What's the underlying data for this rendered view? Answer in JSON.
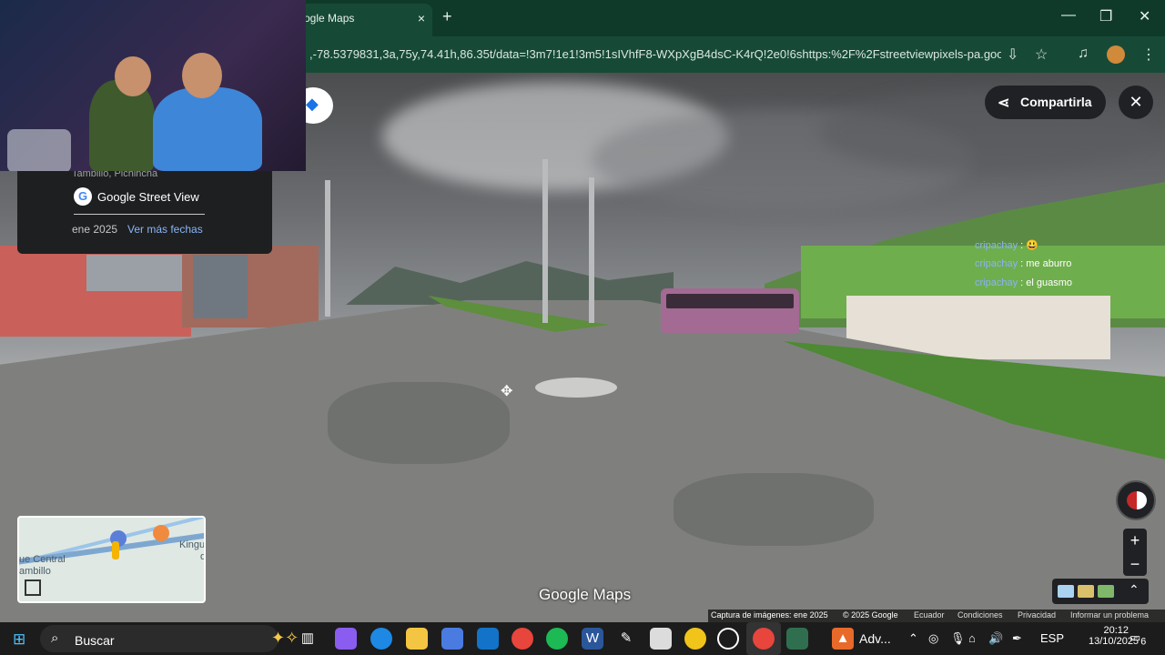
{
  "browser": {
    "tab_title": "ogle Maps",
    "url": ",-78.5379831,3a,75y,74.41h,86.35t/data=!3m7!1e1!3m5!1sIVhfF8-WXpXgB4dsC-K4rQ!2e0!6shttps:%2F%2Fstreetviewpixels-pa.goo...",
    "new_tab_symbol": "+",
    "close_tab_symbol": "×",
    "minimize_symbol": "—",
    "restore_symbol": "❐",
    "close_window_symbol": "✕",
    "tab_bar_color": "#0f3a2a"
  },
  "info_panel": {
    "location": "Tambillo, Pichincha",
    "source": "Google Street View",
    "date": "ene 2025",
    "more_dates": "Ver más fechas"
  },
  "controls": {
    "share_label": "Compartirla",
    "close_symbol": "✕",
    "zoom_in": "+",
    "zoom_out": "−"
  },
  "chat": [
    {
      "user": "cripachay",
      "message": "😃"
    },
    {
      "user": "cripachay",
      "message": "me aburro"
    },
    {
      "user": "cripachay",
      "message": "el guasmo"
    }
  ],
  "minimap": {
    "label_left": "ue Central",
    "label_left2": "ambillo",
    "label_right": "Kingu",
    "label_right2": "d"
  },
  "watermark": "Google Maps",
  "footer": {
    "capture": "Captura de imágenes: ene 2025",
    "copyright": "© 2025 Google",
    "country": "Ecuador",
    "terms": "Condiciones",
    "privacy": "Privacidad",
    "report": "Informar un problema"
  },
  "taskbar": {
    "search_label": "Buscar",
    "active_app_label": "Adv...",
    "language": "ESP",
    "time": "20:12",
    "date": "13/10/2025",
    "notifications": "6",
    "apps": [
      "task-view",
      "copilot",
      "edge",
      "file-explorer",
      "store",
      "outlook",
      "chrome",
      "spotify",
      "word",
      "pen",
      "files",
      "money",
      "clock",
      "chrome-active",
      "game"
    ]
  }
}
